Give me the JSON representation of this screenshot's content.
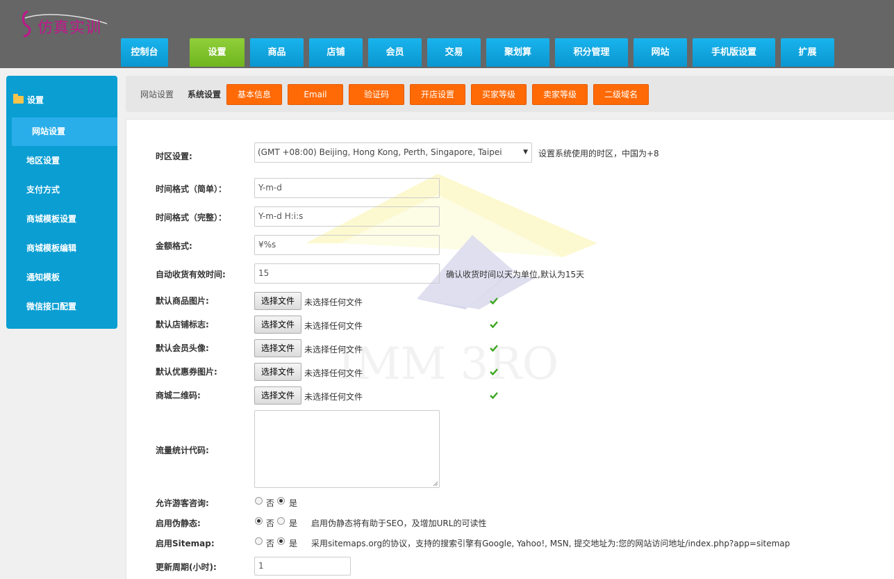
{
  "header": {
    "logo_text": "仿真实训",
    "nav": [
      {
        "label": "控制台",
        "active": false
      },
      {
        "label": "设置",
        "active": true
      },
      {
        "label": "商品",
        "active": false
      },
      {
        "label": "店铺",
        "active": false
      },
      {
        "label": "会员",
        "active": false
      },
      {
        "label": "交易",
        "active": false
      },
      {
        "label": "聚划算",
        "active": false
      },
      {
        "label": "积分管理",
        "active": false
      },
      {
        "label": "网站",
        "active": false
      },
      {
        "label": "手机版设置",
        "active": false
      },
      {
        "label": "扩展",
        "active": false
      }
    ]
  },
  "sidebar": {
    "heading": "设置",
    "items": [
      {
        "label": "网站设置",
        "active": true
      },
      {
        "label": "地区设置",
        "active": false
      },
      {
        "label": "支付方式",
        "active": false
      },
      {
        "label": "商城模板设置",
        "active": false
      },
      {
        "label": "商城模板编辑",
        "active": false
      },
      {
        "label": "通知模板",
        "active": false
      },
      {
        "label": "微信接口配置",
        "active": false
      }
    ]
  },
  "topbar": {
    "crumb_site": "网站设置",
    "crumb_system": "系统设置",
    "tabs": [
      "基本信息",
      "Email",
      "验证码",
      "开店设置",
      "买家等级",
      "卖家等级",
      "二级域名"
    ]
  },
  "form": {
    "timezone": {
      "label": "时区设置:",
      "value": "(GMT +08:00) Beijing, Hong Kong, Perth, Singapore, Taipei",
      "hint": "设置系统使用的时区，中国为+8"
    },
    "date_short": {
      "label": "时间格式（简单）：",
      "value": "Y-m-d"
    },
    "date_full": {
      "label": "时间格式（完整）：",
      "value": "Y-m-d H:i:s"
    },
    "money": {
      "label": "金额格式:",
      "value": "¥%s"
    },
    "auto_receive": {
      "label": "自动收货有效时间:",
      "value": "15",
      "hint": "确认收货时间以天为单位,默认为15天"
    },
    "file_button": "选择文件",
    "file_none": "未选择任何文件",
    "files": [
      {
        "label": "默认商品图片:"
      },
      {
        "label": "默认店铺标志:"
      },
      {
        "label": "默认会员头像:"
      },
      {
        "label": "默认优惠券图片:"
      },
      {
        "label": "商城二维码:"
      }
    ],
    "stats_code": {
      "label": "流量统计代码:",
      "value": ""
    },
    "radio_no": "否",
    "radio_yes": "是",
    "guest_consult": {
      "label": "允许游客咨询:",
      "selected": "yes"
    },
    "rewrite": {
      "label": "启用伪静态:",
      "selected": "no",
      "hint": "启用伪静态将有助于SEO，及增加URL的可读性"
    },
    "sitemap": {
      "label": "启用Sitemap:",
      "selected": "yes",
      "hint": "采用sitemaps.org的协议，支持的搜索引擎有Google, Yahoo!, MSN, 提交地址为:您的网站访问地址/index.php?app=sitemap"
    },
    "update_cycle": {
      "label": "更新周期(小时):",
      "value": "1"
    }
  },
  "watermark_text": "IMM 3RO",
  "colors": {
    "header_bg": "#666666",
    "nav_blue": "#0a9ed3",
    "nav_active": "#7cc22a",
    "tab_orange": "#ff6a06",
    "logo_magenta": "#c0178c"
  }
}
